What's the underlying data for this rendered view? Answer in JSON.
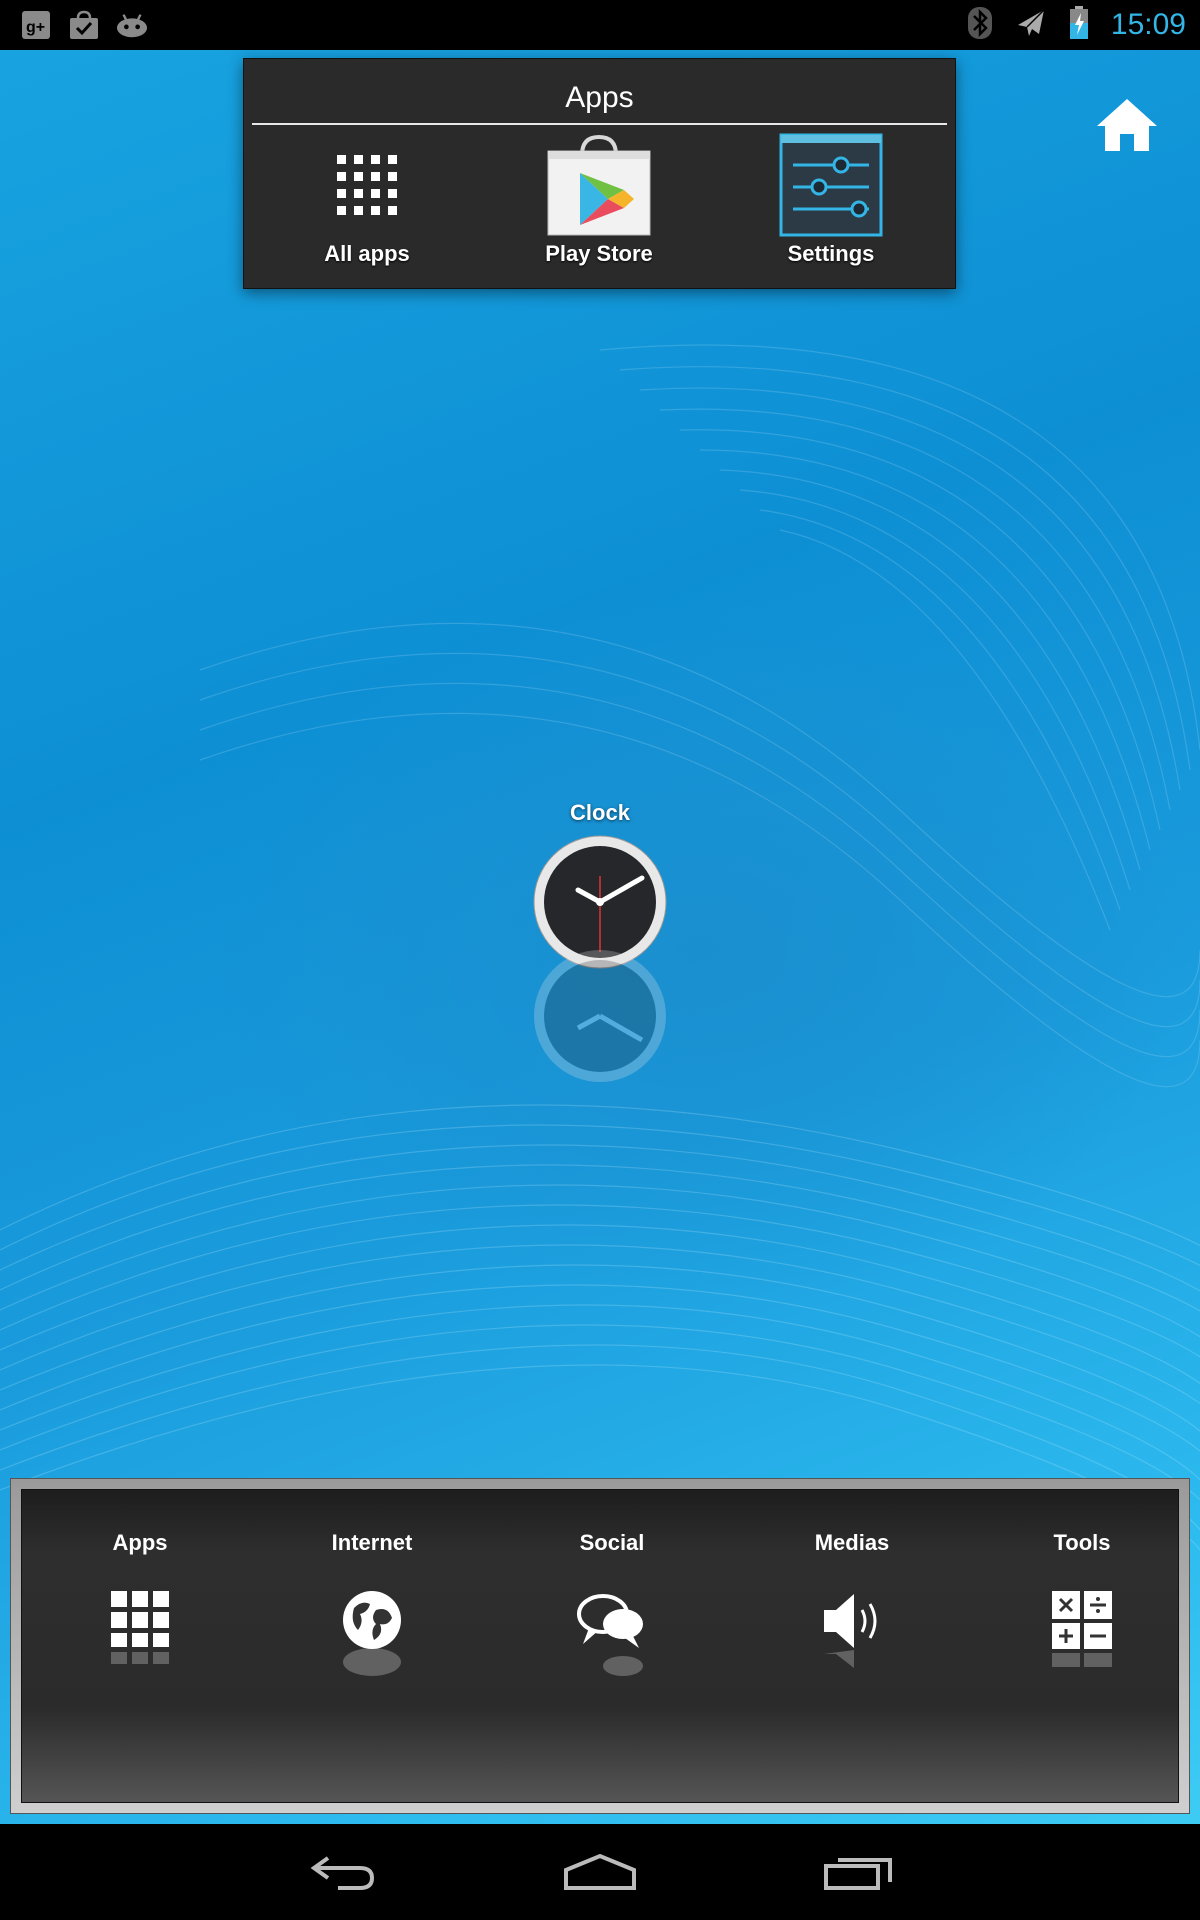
{
  "status_bar": {
    "left_icons": [
      "google-plus-icon",
      "shopping-bag-icon",
      "android-icon"
    ],
    "right_icons": [
      "bluetooth-icon",
      "airplane-mode-icon",
      "battery-charging-icon"
    ],
    "time": "15:09",
    "time_color": "#33b5e5"
  },
  "folder": {
    "title": "Apps",
    "items": [
      {
        "label": "All apps",
        "icon": "grid-icon"
      },
      {
        "label": "Play Store",
        "icon": "play-store-icon"
      },
      {
        "label": "Settings",
        "icon": "settings-sliders-icon"
      }
    ]
  },
  "clock_widget": {
    "label": "Clock"
  },
  "dock": {
    "items": [
      {
        "label": "Apps",
        "icon": "grid-icon"
      },
      {
        "label": "Internet",
        "icon": "globe-icon"
      },
      {
        "label": "Social",
        "icon": "chat-bubbles-icon"
      },
      {
        "label": "Medias",
        "icon": "speaker-icon"
      },
      {
        "label": "Tools",
        "icon": "calculator-icon"
      }
    ]
  },
  "nav_bar": {
    "buttons": [
      "back-icon",
      "home-icon",
      "recent-apps-icon"
    ]
  }
}
